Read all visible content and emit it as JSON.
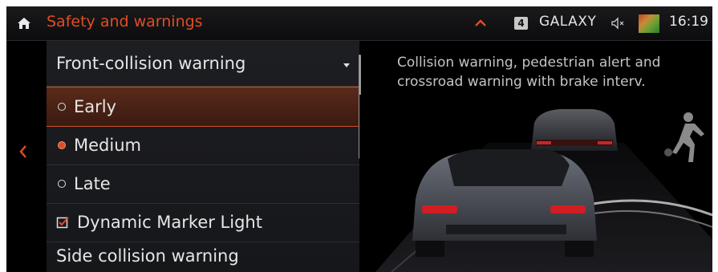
{
  "statusbar": {
    "title": "Safety and warnings",
    "preset_number": "4",
    "station": "GALAXY",
    "time": "16:19",
    "icons": [
      "home-icon",
      "chevron-up-icon",
      "speaker-mute-icon",
      "profile-avatar"
    ]
  },
  "menu": {
    "dropdown_label": "Front-collision warning",
    "options": [
      {
        "label": "Early",
        "selected": false,
        "highlighted": true
      },
      {
        "label": "Medium",
        "selected": true,
        "highlighted": false
      },
      {
        "label": "Late",
        "selected": false,
        "highlighted": false
      }
    ],
    "checkbox": {
      "label": "Dynamic Marker Light",
      "checked": true
    },
    "next_item": "Side collision warning"
  },
  "detail": {
    "description": "Collision warning, pedestrian alert and crossroad warning with brake interv."
  },
  "colors": {
    "accent": "#e04d24",
    "background": "#000000",
    "panel": "#1b1c20"
  }
}
